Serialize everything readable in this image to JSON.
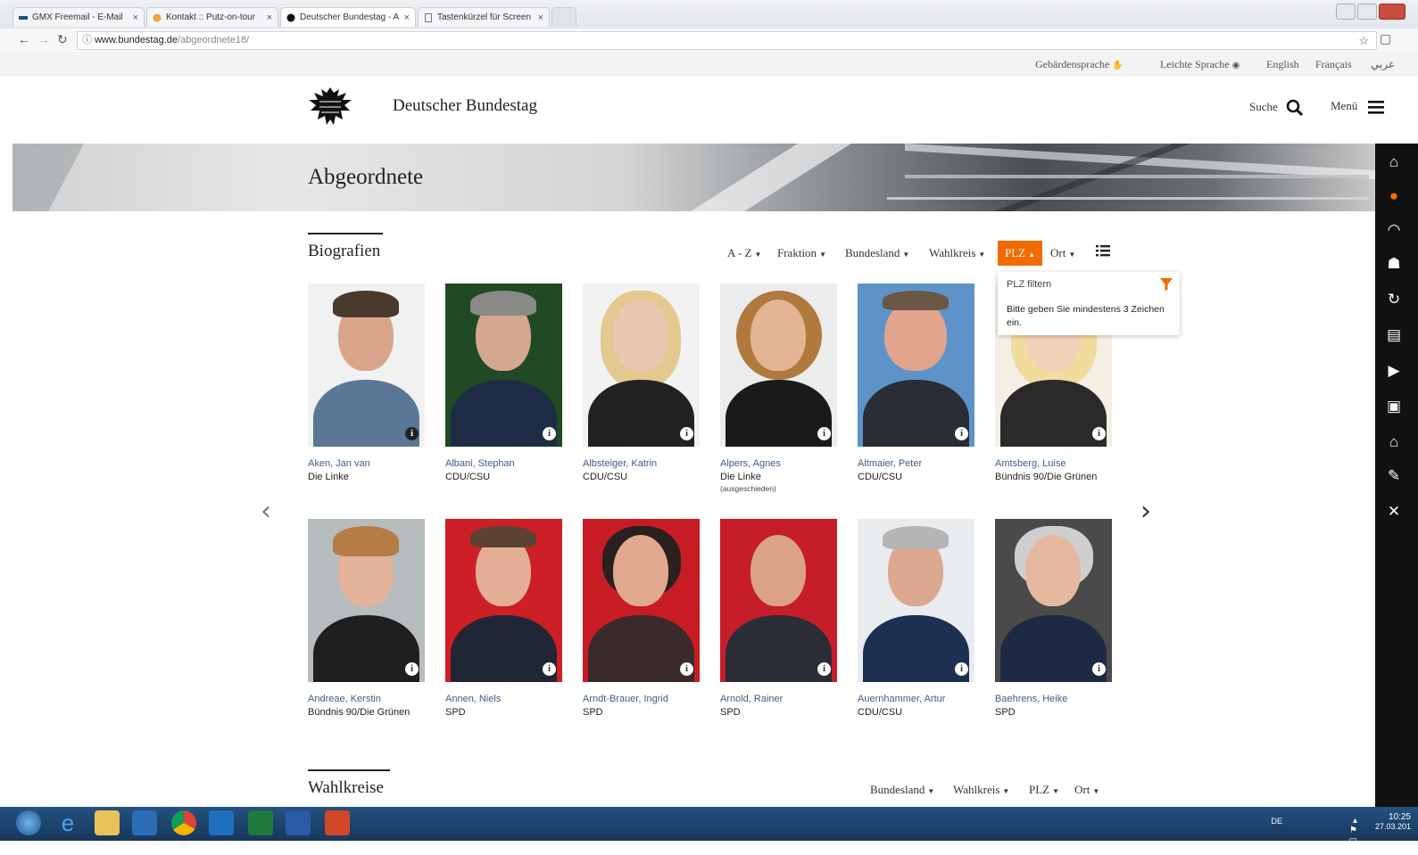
{
  "browser": {
    "tabs": [
      {
        "label": "GMX Freemail - E-Mail ",
        "active": false
      },
      {
        "label": "Kontakt :: Putz-on-tour",
        "active": false
      },
      {
        "label": "Deutscher Bundestag - A",
        "active": true
      },
      {
        "label": "Tastenkürzel für Screen",
        "active": false
      }
    ],
    "url_domain": "www.bundestag.de",
    "url_path": "/abgeordnete18/",
    "back_icon": "back-arrow-icon",
    "forward_icon": "forward-arrow-icon",
    "reload_icon": "reload-icon",
    "bookmark_icon": "star-icon"
  },
  "lang_bar": {
    "sign_language": "Gebärdensprache",
    "easy_language": "Leichte Sprache",
    "english": "English",
    "french": "Français",
    "arabic": "عربي"
  },
  "header": {
    "title": "Deutscher Bundestag",
    "search_label": "Suche",
    "menu_label": "Menü"
  },
  "hero": {
    "title": "Abgeordnete"
  },
  "biografien": {
    "title": "Biografien",
    "filters": {
      "az": "A - Z",
      "fraktion": "Fraktion",
      "bundesland": "Bundesland",
      "wahlkreis": "Wahlkreis",
      "plz": "PLZ",
      "ort": "Ort"
    },
    "plz_dropdown": {
      "placeholder": "PLZ filtern",
      "hint": "Bitte geben Sie mindestens 3 Zeichen ein."
    },
    "members": [
      {
        "name": "Aken, Jan van",
        "party": "Die Linke",
        "note": ""
      },
      {
        "name": "Albani, Stephan",
        "party": "CDU/CSU",
        "note": ""
      },
      {
        "name": "Albsteiger, Katrin",
        "party": "CDU/CSU",
        "note": ""
      },
      {
        "name": "Alpers, Agnes",
        "party": "Die Linke",
        "note": "(ausgeschieden)"
      },
      {
        "name": "Altmaier, Peter",
        "party": "CDU/CSU",
        "note": ""
      },
      {
        "name": "Amtsberg, Luise",
        "party": "Bündnis 90/Die Grünen",
        "note": ""
      },
      {
        "name": "Andreae, Kerstin",
        "party": "Bündnis 90/Die Grünen",
        "note": ""
      },
      {
        "name": "Annen, Niels",
        "party": "SPD",
        "note": ""
      },
      {
        "name": "Arndt-Brauer, Ingrid",
        "party": "SPD",
        "note": ""
      },
      {
        "name": "Arnold, Rainer",
        "party": "SPD",
        "note": ""
      },
      {
        "name": "Auernhammer, Artur",
        "party": "CDU/CSU",
        "note": ""
      },
      {
        "name": "Baehrens, Heike",
        "party": "SPD",
        "note": ""
      }
    ]
  },
  "wahlkreise": {
    "title": "Wahlkreise",
    "filters": {
      "bundesland": "Bundesland",
      "wahlkreis": "Wahlkreis",
      "plz": "PLZ",
      "ort": "Ort"
    }
  },
  "taskbar": {
    "lang": "DE",
    "time": "10:25",
    "date": "27.03.201"
  },
  "colors": {
    "accent": "#f26b00",
    "sidebar": "#111111",
    "name_link": "#3d5d8a",
    "taskbar": "#1d4470"
  }
}
